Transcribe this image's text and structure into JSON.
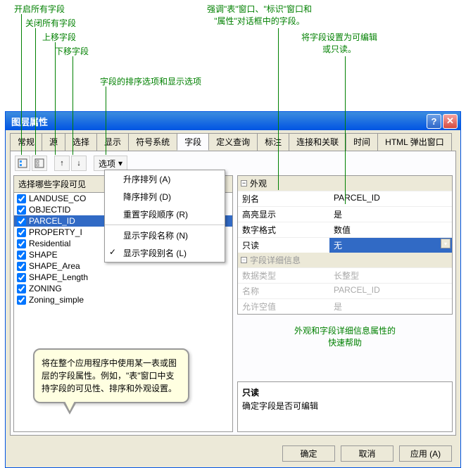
{
  "annotations": {
    "a1": "开启所有字段",
    "a2": "关闭所有字段",
    "a3": "上移字段",
    "a4": "下移字段",
    "a5": "字段的排序选项和显示选项",
    "a6_l1": "强调\"表\"窗口、\"标识\"窗口和",
    "a6_l2": "\"属性\"对话框中的字段。",
    "a7_l1": "将字段设置为可编辑",
    "a7_l2": "或只读。"
  },
  "window_title": "图层属性",
  "tabs": [
    "常规",
    "源",
    "选择",
    "显示",
    "符号系统",
    "字段",
    "定义查询",
    "标注",
    "连接和关联",
    "时间",
    "HTML 弹出窗口"
  ],
  "active_tab": 5,
  "options_label": "选项",
  "menu": {
    "sort_asc": "升序排列 (A)",
    "sort_desc": "降序排列 (D)",
    "reset_order": "重置字段顺序 (R)",
    "show_names": "显示字段名称 (N)",
    "show_aliases": "显示字段别名 (L)"
  },
  "left_header": "选择哪些字段可见",
  "fields": [
    {
      "name": "LANDUSE_CO",
      "checked": true,
      "selected": false
    },
    {
      "name": "OBJECTID",
      "checked": true,
      "selected": false
    },
    {
      "name": "PARCEL_ID",
      "checked": true,
      "selected": true
    },
    {
      "name": "PROPERTY_I",
      "checked": true,
      "selected": false
    },
    {
      "name": "Residential",
      "checked": true,
      "selected": false
    },
    {
      "name": "SHAPE",
      "checked": true,
      "selected": false
    },
    {
      "name": "SHAPE_Area",
      "checked": true,
      "selected": false
    },
    {
      "name": "SHAPE_Length",
      "checked": true,
      "selected": false
    },
    {
      "name": "ZONING",
      "checked": true,
      "selected": false
    },
    {
      "name": "Zoning_simple",
      "checked": true,
      "selected": false
    }
  ],
  "props": {
    "section1": "外观",
    "alias_label": "别名",
    "alias_value": "PARCEL_ID",
    "highlight_label": "高亮显示",
    "highlight_value": "是",
    "numfmt_label": "数字格式",
    "numfmt_value": "数值",
    "readonly_label": "只读",
    "readonly_value": "无",
    "section2": "字段详细信息",
    "datatype_label": "数据类型",
    "datatype_value": "长整型",
    "name_label": "名称",
    "name_value": "PARCEL_ID",
    "nullable_label": "允许空值",
    "nullable_value": "是"
  },
  "green_callout_l1": "外观和字段详细信息属性的",
  "green_callout_l2": "快速帮助",
  "help": {
    "title": "只读",
    "desc": "确定字段是否可编辑"
  },
  "bubble": "将在整个应用程序中使用某一表或图层的字段属性。例如，\"表\"窗口中支持字段的可见性、排序和外观设置。",
  "buttons": {
    "ok": "确定",
    "cancel": "取消",
    "apply": "应用 (A)"
  }
}
